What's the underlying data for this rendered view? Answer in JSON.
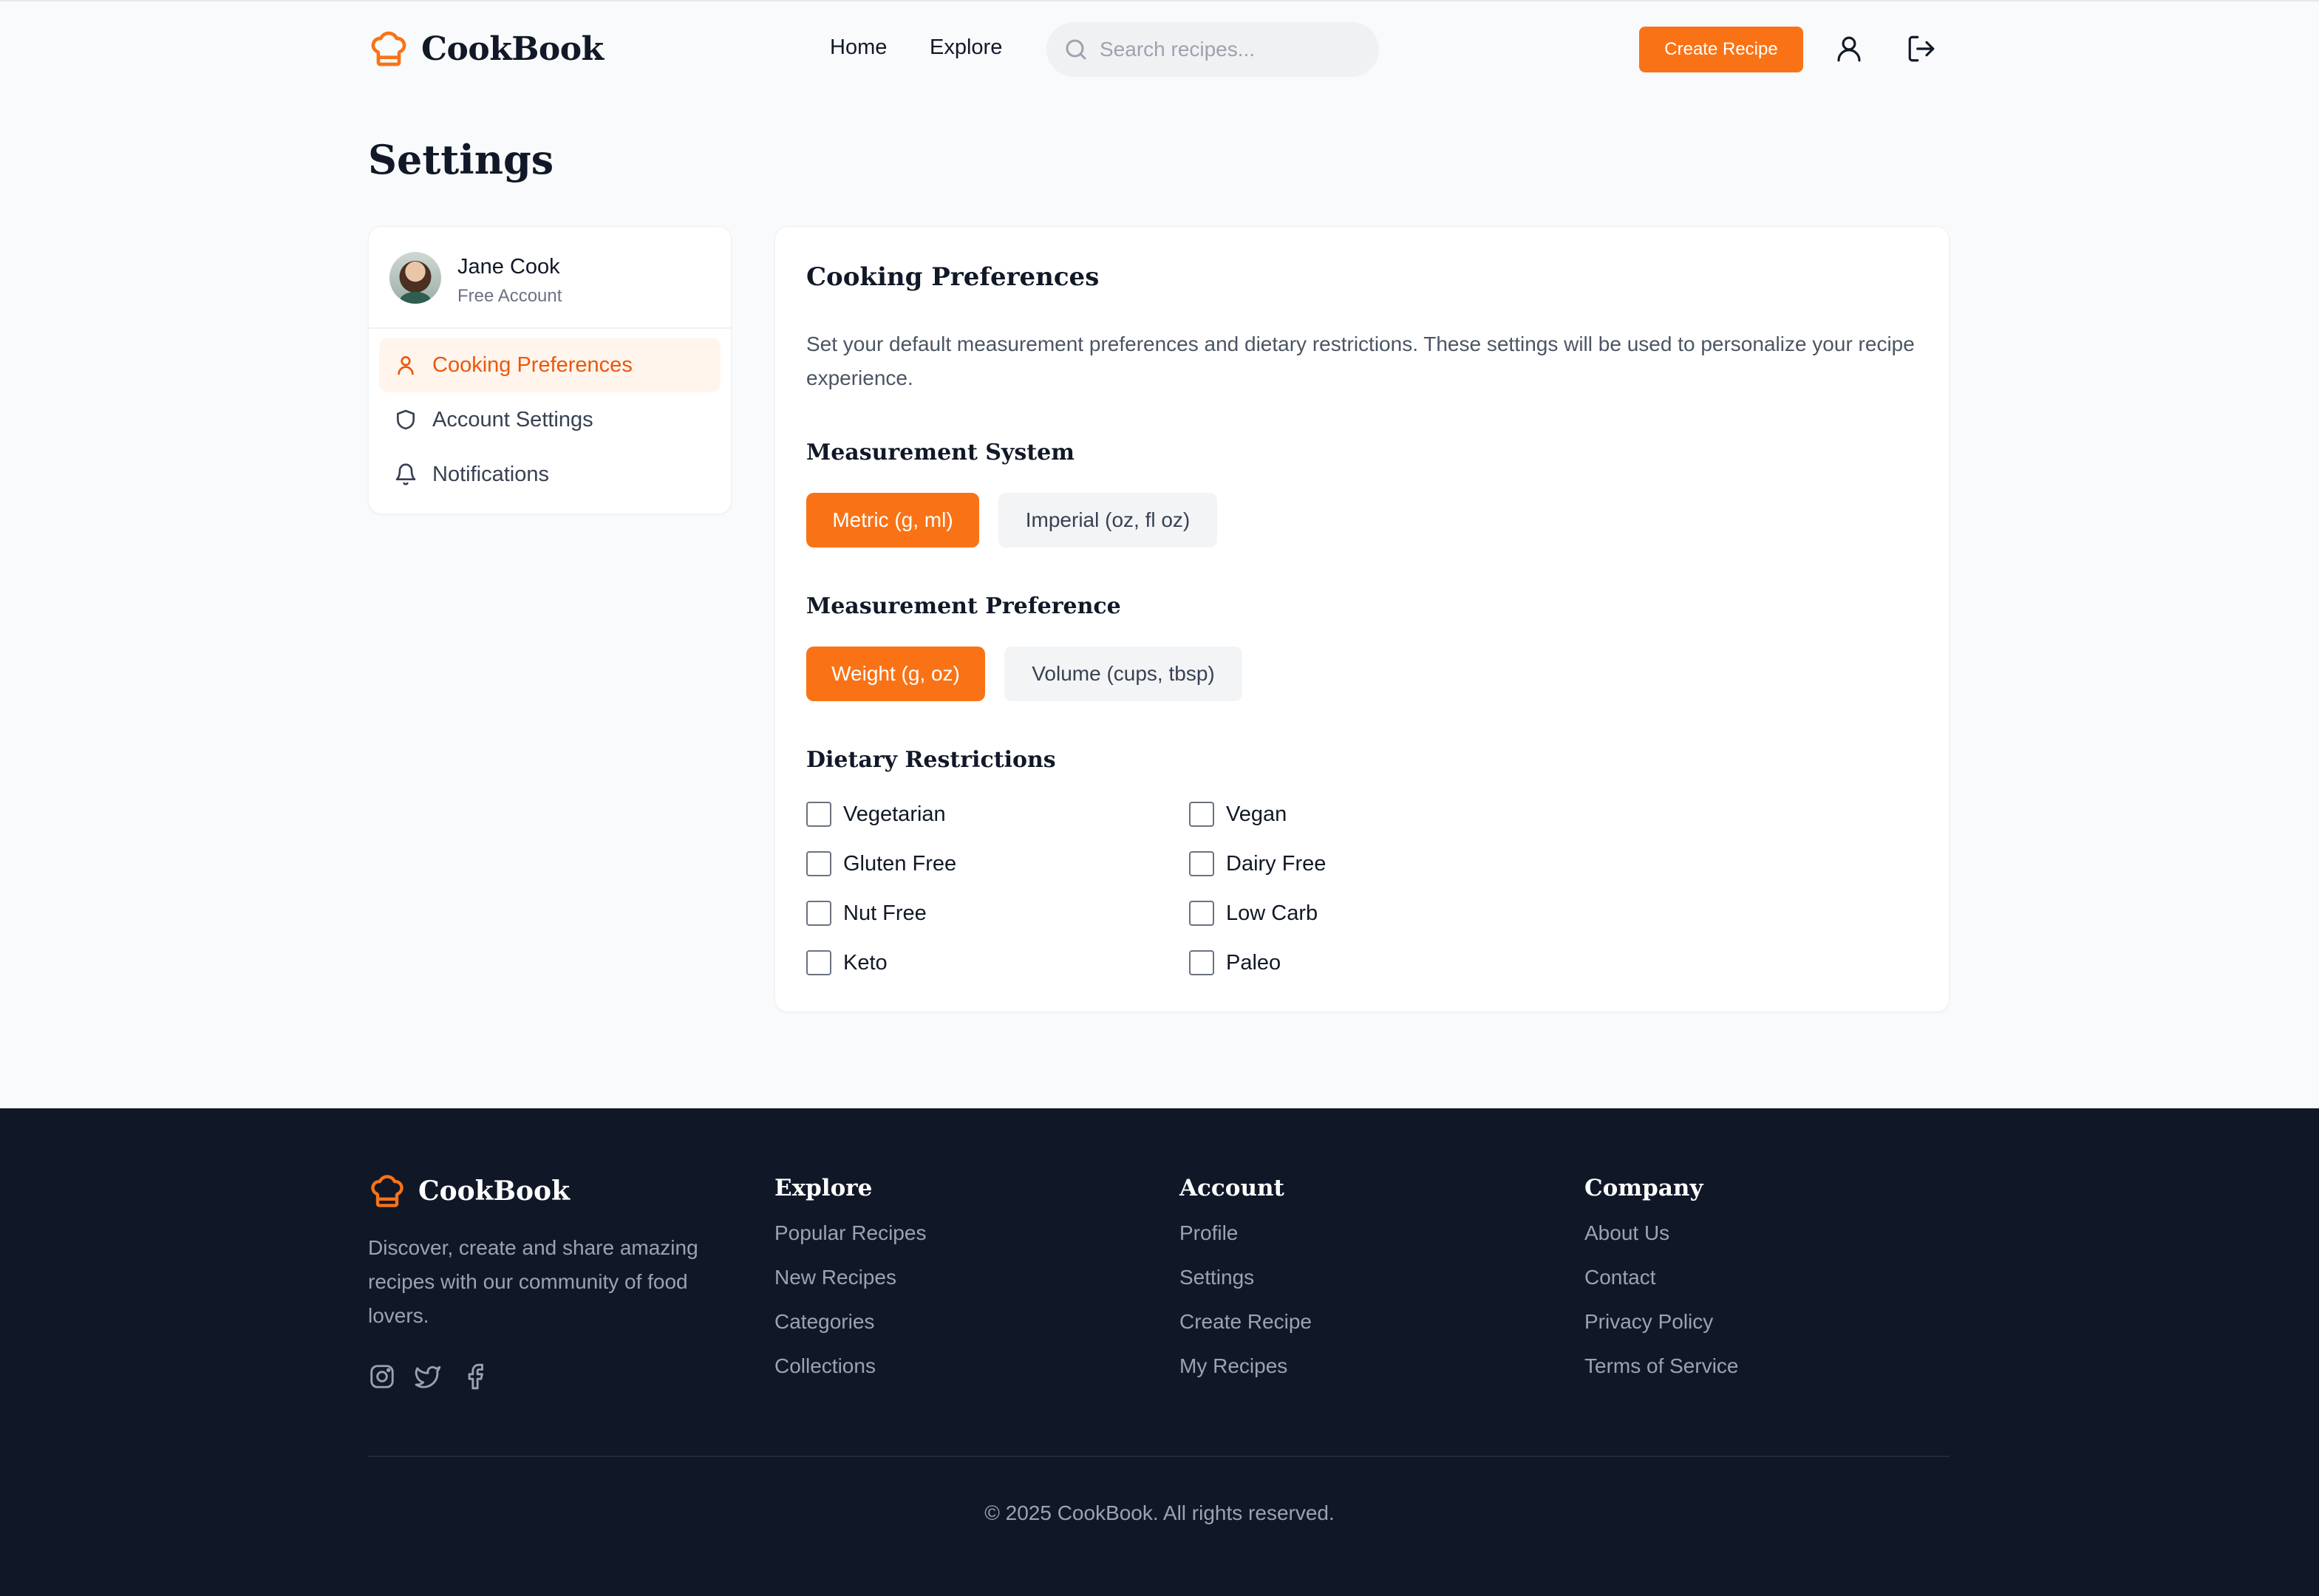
{
  "header": {
    "brand": "CookBook",
    "nav": [
      "Home",
      "Explore"
    ],
    "search_placeholder": "Search recipes...",
    "create_label": "Create Recipe",
    "accent": "#f97316"
  },
  "page": {
    "title": "Settings"
  },
  "sidebar": {
    "user_name": "Jane Cook",
    "user_plan": "Free Account",
    "items": [
      {
        "label": "Cooking Preferences",
        "icon": "user-icon",
        "active": true
      },
      {
        "label": "Account Settings",
        "icon": "shield-icon",
        "active": false
      },
      {
        "label": "Notifications",
        "icon": "bell-icon",
        "active": false
      }
    ]
  },
  "prefs": {
    "title": "Cooking Preferences",
    "description": "Set your default measurement preferences and dietary restrictions. These settings will be used to personalize your recipe experience.",
    "measurement_system": {
      "title": "Measurement System",
      "options": [
        "Metric (g, ml)",
        "Imperial (oz, fl oz)"
      ],
      "selected": "Metric (g, ml)"
    },
    "measurement_preference": {
      "title": "Measurement Preference",
      "options": [
        "Weight (g, oz)",
        "Volume (cups, tbsp)"
      ],
      "selected": "Weight (g, oz)"
    },
    "dietary": {
      "title": "Dietary Restrictions",
      "items": [
        {
          "label": "Vegetarian",
          "checked": false
        },
        {
          "label": "Vegan",
          "checked": false
        },
        {
          "label": "Gluten Free",
          "checked": false
        },
        {
          "label": "Dairy Free",
          "checked": false
        },
        {
          "label": "Nut Free",
          "checked": false
        },
        {
          "label": "Low Carb",
          "checked": false
        },
        {
          "label": "Keto",
          "checked": false
        },
        {
          "label": "Paleo",
          "checked": false
        }
      ]
    }
  },
  "footer": {
    "brand": "CookBook",
    "tagline": "Discover, create and share amazing recipes with our community of food lovers.",
    "social": [
      "instagram-icon",
      "twitter-icon",
      "facebook-icon"
    ],
    "columns": [
      {
        "title": "Explore",
        "links": [
          "Popular Recipes",
          "New Recipes",
          "Categories",
          "Collections"
        ]
      },
      {
        "title": "Account",
        "links": [
          "Profile",
          "Settings",
          "Create Recipe",
          "My Recipes"
        ]
      },
      {
        "title": "Company",
        "links": [
          "About Us",
          "Contact",
          "Privacy Policy",
          "Terms of Service"
        ]
      }
    ],
    "copyright": "© 2025 CookBook. All rights reserved."
  }
}
